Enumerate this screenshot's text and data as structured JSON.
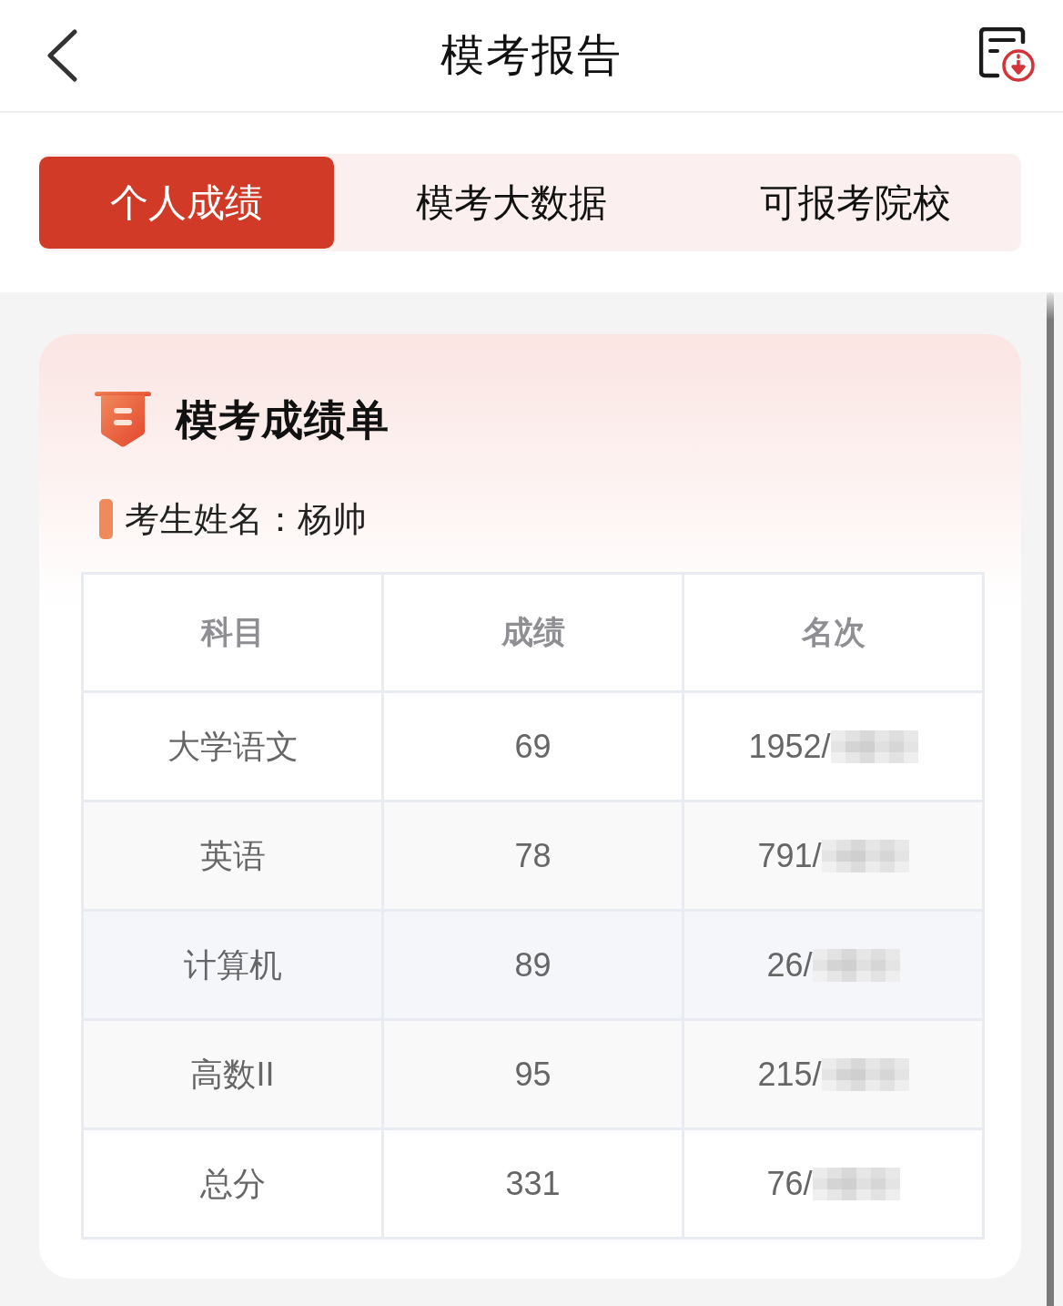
{
  "header": {
    "title": "模考报告"
  },
  "tabs": [
    {
      "label": "个人成绩",
      "selected": true
    },
    {
      "label": "模考大数据",
      "selected": false
    },
    {
      "label": "可报考院校",
      "selected": false
    }
  ],
  "report_card": {
    "title": "模考成绩单",
    "student_line": "考生姓名：杨帅",
    "table": {
      "columns": [
        "科目",
        "成绩",
        "名次"
      ],
      "rows": [
        {
          "subject": "大学语文",
          "score": "69",
          "rank": "1952/",
          "color": "#ffffff"
        },
        {
          "subject": "英语",
          "score": "78",
          "rank": "791/",
          "color": "#f9f9f9"
        },
        {
          "subject": "计算机",
          "score": "89",
          "rank": "26/",
          "color": "#f4f6fa"
        },
        {
          "subject": "高数II",
          "score": "95",
          "rank": "215/",
          "color": "#f9f9f9"
        },
        {
          "subject": "总分",
          "score": "331",
          "rank": "76/",
          "color": "#ffffff"
        }
      ]
    }
  }
}
